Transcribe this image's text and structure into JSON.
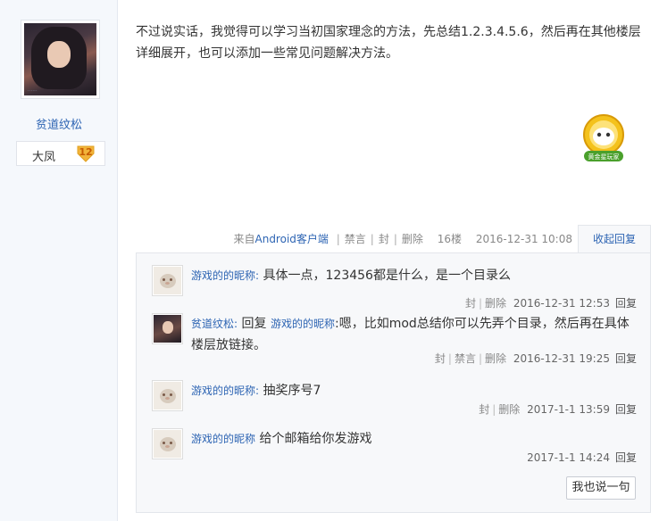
{
  "author": {
    "name": "贫道纹松",
    "badge_name": "大凤",
    "badge_level": "12"
  },
  "post": {
    "text": "不过说实话，我觉得可以学习当初国家理念的方法，先总结1.2.3.4.5.6，然后再在其他楼层详细展开，也可以添加一些常见问题解决方法。",
    "medal_label": "黄金星玩家"
  },
  "post_meta": {
    "source_prefix": "来自",
    "source_link": "Android客户端",
    "ban": "禁言",
    "block": "封",
    "delete": "删除",
    "floor": "16楼",
    "time": "2016-12-31 10:08",
    "collapse_reply": "收起回复"
  },
  "replies": [
    {
      "nick": "游戏的的昵称",
      "sep": ":",
      "text": "具体一点，123456都是什么，是一个目录么",
      "actions": [
        "封",
        "删除"
      ],
      "time": "2016-12-31 12:53",
      "reply_label": "回复"
    },
    {
      "nick": "贫道纹松",
      "sep": ":",
      "reply_word": "回复",
      "reply_to": "游戏的的昵称",
      "text": ":嗯，比如mod总结你可以先弄个目录，然后再在具体楼层放链接。",
      "actions": [
        "封",
        "禁言",
        "删除"
      ],
      "time": "2016-12-31 19:25",
      "reply_label": "回复"
    },
    {
      "nick": "游戏的的昵称",
      "sep": ":",
      "text": "抽奖序号7",
      "actions": [
        "封",
        "删除"
      ],
      "time": "2017-1-1 13:59",
      "reply_label": "回复"
    },
    {
      "nick": "游戏的的昵称",
      "sep": "",
      "text": "给个邮箱给你发游戏",
      "actions": [],
      "time": "2017-1-1 14:24",
      "reply_label": "回复"
    }
  ],
  "say_button": "我也说一句",
  "colors": {
    "link": "#2d64b3",
    "sidebar_bg": "#f5f8fc",
    "reply_bg": "#f7f8fa",
    "level_badge": "#f2b43a"
  }
}
